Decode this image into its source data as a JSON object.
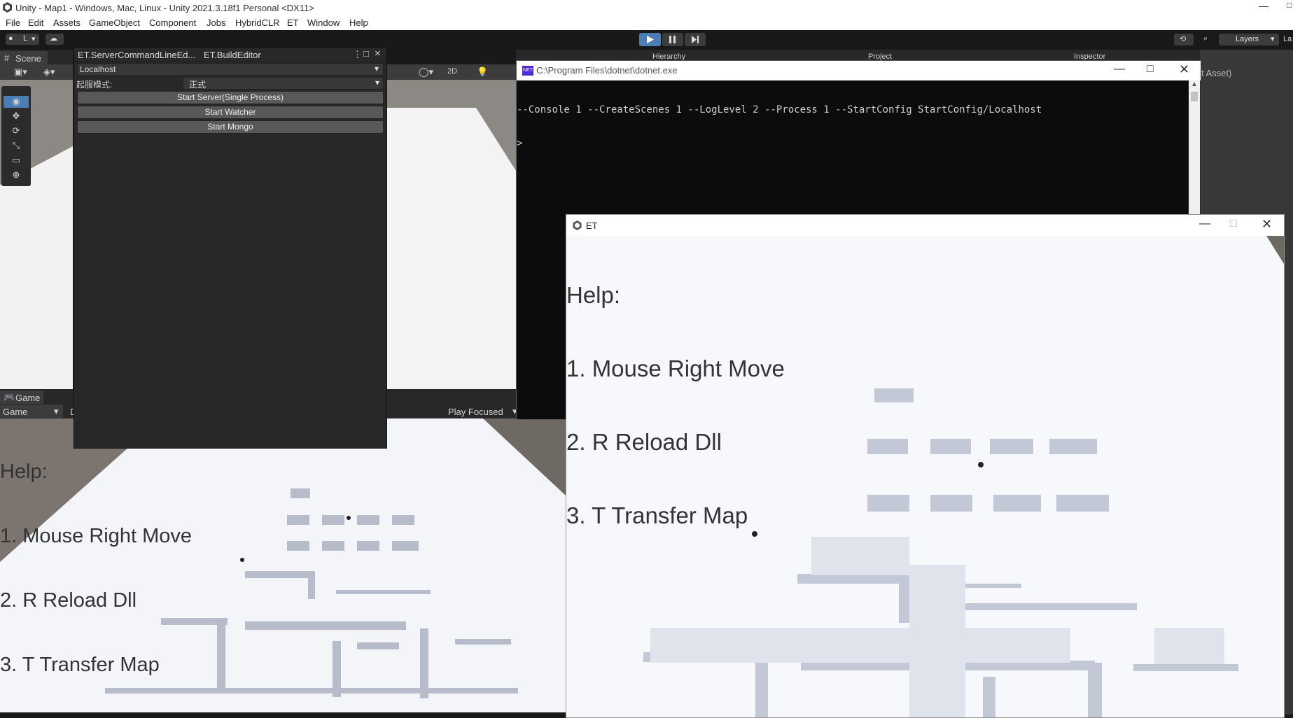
{
  "window": {
    "title": "Unity - Map1 - Windows, Mac, Linux - Unity 2021.3.18f1 Personal <DX11>"
  },
  "menu": [
    "File",
    "Edit",
    "Assets",
    "GameObject",
    "Component",
    "Jobs",
    "HybridCLR",
    "ET",
    "Window",
    "Help"
  ],
  "toolbar": {
    "account": "L",
    "layers": "Layers",
    "layout": "La"
  },
  "scene": {
    "tab": "Scene",
    "mode_2d": "2D"
  },
  "editor": {
    "tab1": "ET.ServerCommandLineEd...",
    "tab2": "ET.BuildEditor",
    "server_select": "Localhost",
    "startup_label": "起服模式:",
    "startup_value": "正式",
    "buttons": [
      "Start Server(Single Process)",
      "Start Watcher",
      "Start Mongo"
    ]
  },
  "background_tabs": {
    "hierarchy": "Hierarchy",
    "project": "Project",
    "inspector": "Inspector",
    "asset_fragment": "t Asset)"
  },
  "console": {
    "title": "C:\\Program Files\\dotnet\\dotnet.exe",
    "command": "--Console 1 --CreateScenes 1 --LogLevel 2 --Process 1 --StartConfig StartConfig/Localhost",
    "prompt": ">"
  },
  "game": {
    "tab": "Game",
    "display": "Game",
    "display_fragment": "D",
    "play_focused": "Play Focused",
    "help": [
      "Help:",
      "1. Mouse Right Move",
      "2. R Reload Dll",
      "3. T Transfer Map"
    ]
  },
  "et_window": {
    "title": "ET",
    "help": [
      "Help:",
      "1. Mouse Right Move",
      "2. R Reload Dll",
      "3. T Transfer Map"
    ]
  },
  "colors": {
    "accent": "#4c7eb6",
    "editor_bg": "#282828",
    "console_bg": "#0c0c0c"
  }
}
